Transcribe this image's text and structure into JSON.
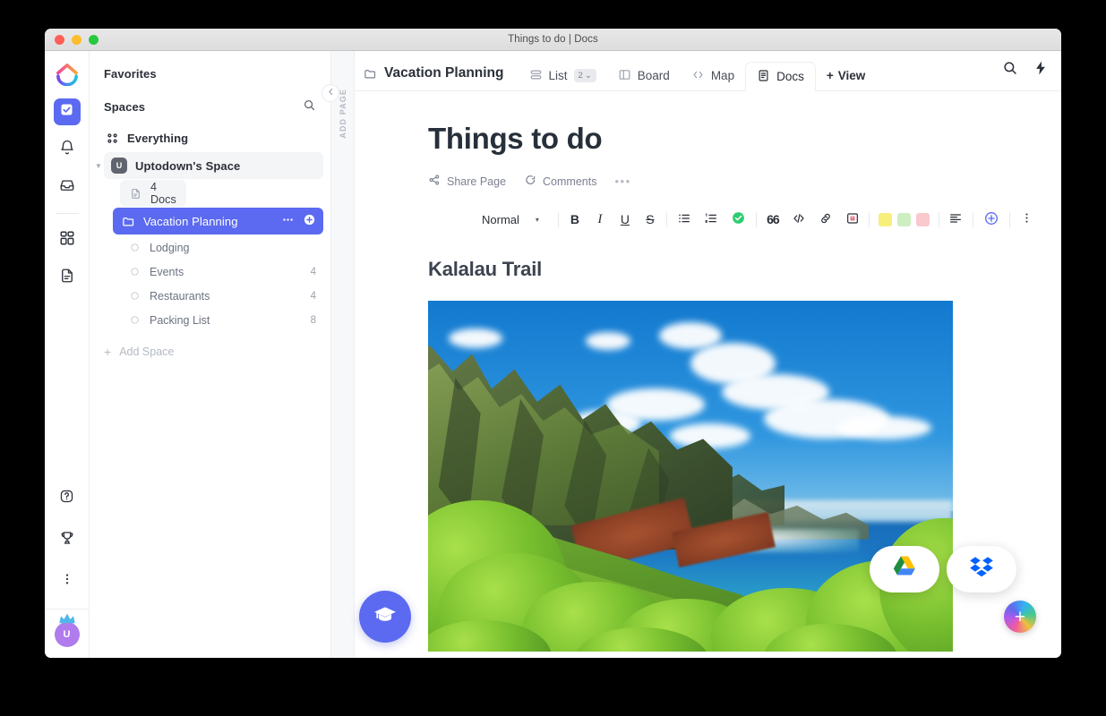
{
  "window": {
    "title": "Things to do | Docs"
  },
  "rail": {
    "logo_icon": "clickup-logo-icon",
    "items": [
      {
        "icon": "checkbox-icon",
        "name": "home",
        "active": true
      },
      {
        "icon": "bell-icon",
        "name": "notifications",
        "active": false
      },
      {
        "icon": "inbox-icon",
        "name": "inbox",
        "active": false
      },
      {
        "icon": "dashboards-grid-icon",
        "name": "dashboards",
        "active": false
      },
      {
        "icon": "docs-page-icon",
        "name": "docs",
        "active": false
      }
    ],
    "bottom_items": [
      {
        "icon": "help-question-icon",
        "name": "help"
      },
      {
        "icon": "trophy-icon",
        "name": "rewards"
      },
      {
        "icon": "more-vertical-icon",
        "name": "more"
      }
    ],
    "avatar": {
      "initial": "U",
      "color": "#b07bed",
      "crown_icon": "crown-icon"
    }
  },
  "sidebar": {
    "favorites_label": "Favorites",
    "spaces_label": "Spaces",
    "search_icon": "search-icon",
    "everything": {
      "label": "Everything",
      "icon": "grid-four-icon"
    },
    "space": {
      "label": "Uptodown's Space",
      "avatar_initial": "U",
      "caret_icon": "caret-down-icon"
    },
    "docs_row": {
      "label": "4 Docs",
      "icon": "doc-icon"
    },
    "selected_folder": {
      "label": "Vacation Planning",
      "icon": "folder-icon",
      "more_icon": "ellipsis-icon",
      "add_icon": "plus-circle-icon",
      "color": "#5b6af0"
    },
    "lists": [
      {
        "label": "Lodging",
        "count": "",
        "icon": "list-dot-icon"
      },
      {
        "label": "Events",
        "count": "4",
        "icon": "list-dot-icon"
      },
      {
        "label": "Restaurants",
        "count": "4",
        "icon": "list-dot-icon"
      },
      {
        "label": "Packing List",
        "count": "8",
        "icon": "list-dot-icon"
      }
    ],
    "add_space_label": "Add Space",
    "collapse_icon": "chevron-left-icon"
  },
  "add_page_strip": {
    "label": "ADD PAGE"
  },
  "topbar": {
    "breadcrumb": "Vacation Planning",
    "breadcrumb_icon": "folder-outline-icon",
    "tabs": [
      {
        "label": "List",
        "icon": "list-view-icon",
        "badge": "2",
        "badge_caret": "⌄",
        "active": false
      },
      {
        "label": "Board",
        "icon": "board-view-icon",
        "badge": "",
        "active": false
      },
      {
        "label": "Map",
        "icon": "map-code-icon",
        "badge": "",
        "active": false
      },
      {
        "label": "Docs",
        "icon": "doc-view-icon",
        "badge": "",
        "active": true
      }
    ],
    "add_view_label": "View",
    "add_view_icon": "plus-icon",
    "right_icons": [
      {
        "name": "search-icon"
      },
      {
        "name": "lightning-bolt-icon"
      }
    ]
  },
  "document": {
    "title": "Things to do",
    "actions": [
      {
        "label": "Share Page",
        "icon": "share-icon"
      },
      {
        "label": "Comments",
        "icon": "comment-icon"
      }
    ],
    "more_icon": "ellipsis-icon",
    "heading": "Kalalau Trail",
    "image_alt": "Kalalau Trail Na Pali coast green cliffs and turquoise ocean"
  },
  "toolbar": {
    "style_label": "Normal",
    "style_caret": "▾",
    "format_buttons": [
      {
        "name": "bold-button",
        "label": "B"
      },
      {
        "name": "italic-button",
        "label": "I"
      },
      {
        "name": "underline-button",
        "label": "U"
      },
      {
        "name": "strikethrough-button",
        "label": "S"
      }
    ],
    "list_buttons": [
      {
        "name": "bullet-list-button",
        "icon": "bullet-list-icon"
      },
      {
        "name": "numbered-list-button",
        "icon": "numbered-list-icon"
      },
      {
        "name": "checklist-button",
        "icon": "check-circle-icon"
      }
    ],
    "insert_buttons": [
      {
        "name": "blockquote-button",
        "label": "66"
      },
      {
        "name": "code-button",
        "label": "</>"
      },
      {
        "name": "link-button",
        "icon": "link-icon"
      },
      {
        "name": "banner-button",
        "icon": "banner-icon"
      }
    ],
    "highlight_swatches": [
      {
        "name": "highlight-yellow",
        "color": "#f6ef7a"
      },
      {
        "name": "highlight-green",
        "color": "#cdeec0"
      },
      {
        "name": "highlight-pink",
        "color": "#fac9cd"
      }
    ],
    "align_button": {
      "name": "align-left-button",
      "icon": "align-left-icon"
    },
    "add_block_button": {
      "name": "add-block-button",
      "icon": "plus-circle-icon",
      "color": "#5b6af0"
    },
    "overflow_button": {
      "name": "toolbar-overflow-button",
      "icon": "more-vertical-icon"
    }
  },
  "floating": {
    "education_button": {
      "name": "education-button",
      "icon": "graduation-cap-icon",
      "color": "#5b6af0"
    },
    "integrations": [
      {
        "name": "google-drive-button",
        "icon": "google-drive-icon"
      },
      {
        "name": "dropbox-button",
        "icon": "dropbox-icon"
      }
    ],
    "add_button": {
      "name": "create-new-button",
      "icon": "plus-icon"
    }
  }
}
